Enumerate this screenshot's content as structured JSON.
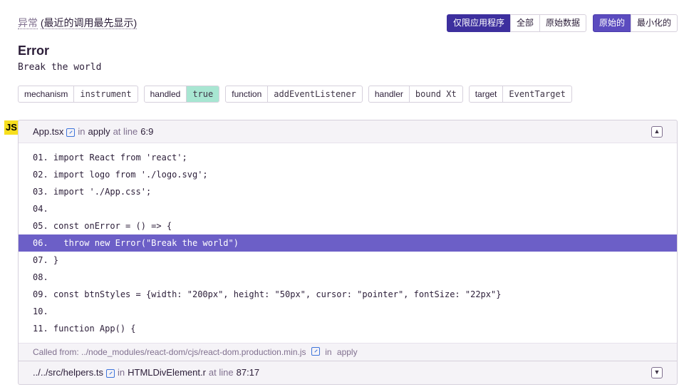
{
  "header": {
    "label": "异常",
    "note": "(最近的调用最先显示)",
    "note_open": "(",
    "note_text": "最近的调用最先显示",
    "note_close": ")"
  },
  "toolbar": {
    "group_a": [
      "仅限应用程序",
      "全部",
      "原始数据"
    ],
    "group_b": [
      "原始的",
      "最小化的"
    ]
  },
  "error": {
    "type": "Error",
    "message": "Break the world"
  },
  "tags": [
    {
      "key": "mechanism",
      "value": "instrument"
    },
    {
      "key": "handled",
      "value": "true"
    },
    {
      "key": "function",
      "value": "addEventListener"
    },
    {
      "key": "handler",
      "value": "bound Xt"
    },
    {
      "key": "target",
      "value": "EventTarget"
    }
  ],
  "platform_badge": "JS",
  "frames": [
    {
      "file": "App.tsx",
      "in": "in",
      "function": "apply",
      "at_line": "at line",
      "line": "6:9",
      "code": [
        "01. import React from 'react';",
        "02. import logo from './logo.svg';",
        "03. import './App.css';",
        "04.",
        "05. const onError = () => {",
        "06.   throw new Error(\"Break the world\")",
        "07. }",
        "08.",
        "09. const btnStyles = {width: \"200px\", height: \"50px\", cursor: \"pointer\", fontSize: \"22px\"}",
        "10.",
        "11. function App() {"
      ],
      "called_from_label": "Called from:",
      "called_from_path": "../node_modules/react-dom/cjs/react-dom.production.min.js",
      "called_from_in": "in",
      "called_from_function": "apply"
    },
    {
      "file": "../../src/helpers.ts",
      "in": "in",
      "function": "HTMLDivElement.r",
      "at_line": "at line",
      "line": "87:17"
    }
  ],
  "icons": {
    "external": "external-link-icon",
    "collapse": "chevron-up-icon",
    "expand": "chevron-down-icon"
  },
  "colors": {
    "accent": "#3d2f9e",
    "highlight": "#6c5fc7",
    "handled": "#a8e6d2",
    "js": "#f7df1e"
  }
}
